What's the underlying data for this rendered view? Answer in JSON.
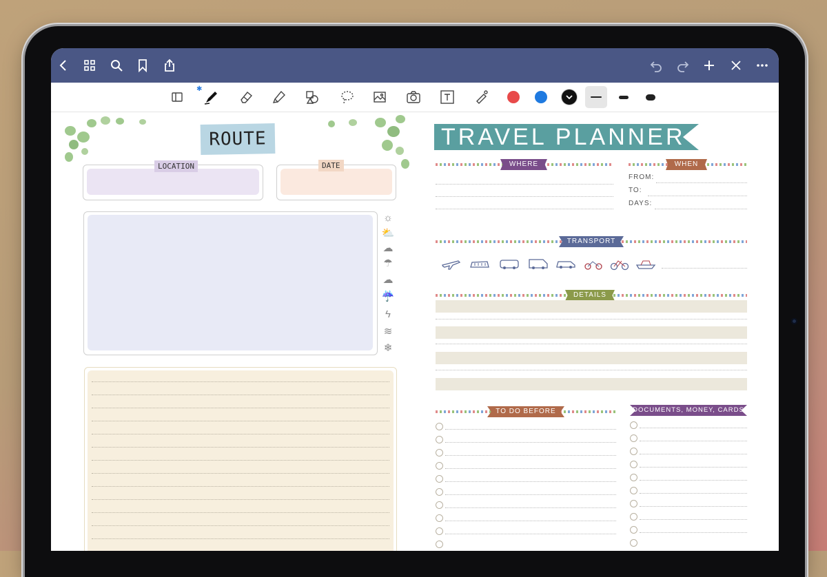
{
  "toolbar_colors": {
    "red": "#e84a4a",
    "blue": "#1f7ae0",
    "black": "#111111"
  },
  "nav_icons": [
    "back-icon",
    "grid-icon",
    "search-icon",
    "bookmark-icon",
    "share-icon",
    "undo-icon",
    "redo-icon",
    "add-page-icon",
    "close-icon",
    "more-icon"
  ],
  "tools": [
    "page-layout-icon",
    "pen-icon",
    "eraser-icon",
    "highlighter-icon",
    "shapes-icon",
    "lasso-icon",
    "image-icon",
    "camera-icon",
    "text-icon",
    "laser-icon"
  ],
  "left_page": {
    "title": "ROUTE",
    "location_label": "LOCATION",
    "date_label": "DATE",
    "weather_icons": [
      "sun-icon",
      "partly-cloudy-icon",
      "cloud-icon",
      "sun-rain-icon",
      "rain-icon",
      "heavy-rain-icon",
      "thunder-icon",
      "wind-icon",
      "snow-icon"
    ]
  },
  "right_page": {
    "title": "TRAVEL PLANNER",
    "where": "WHERE",
    "when": "WHEN",
    "from": "FROM:",
    "to": "TO:",
    "days": "DAYS:",
    "transport": "TRANSPORT",
    "transport_icons": [
      "plane-icon",
      "train-icon",
      "bus-icon",
      "camper-icon",
      "car-icon",
      "motorbike-icon",
      "bicycle-icon",
      "ship-icon"
    ],
    "details": "DETAILS",
    "todo": "TO DO BEFORE",
    "documents": "DOCUMENTS, MONEY, CARDS"
  }
}
